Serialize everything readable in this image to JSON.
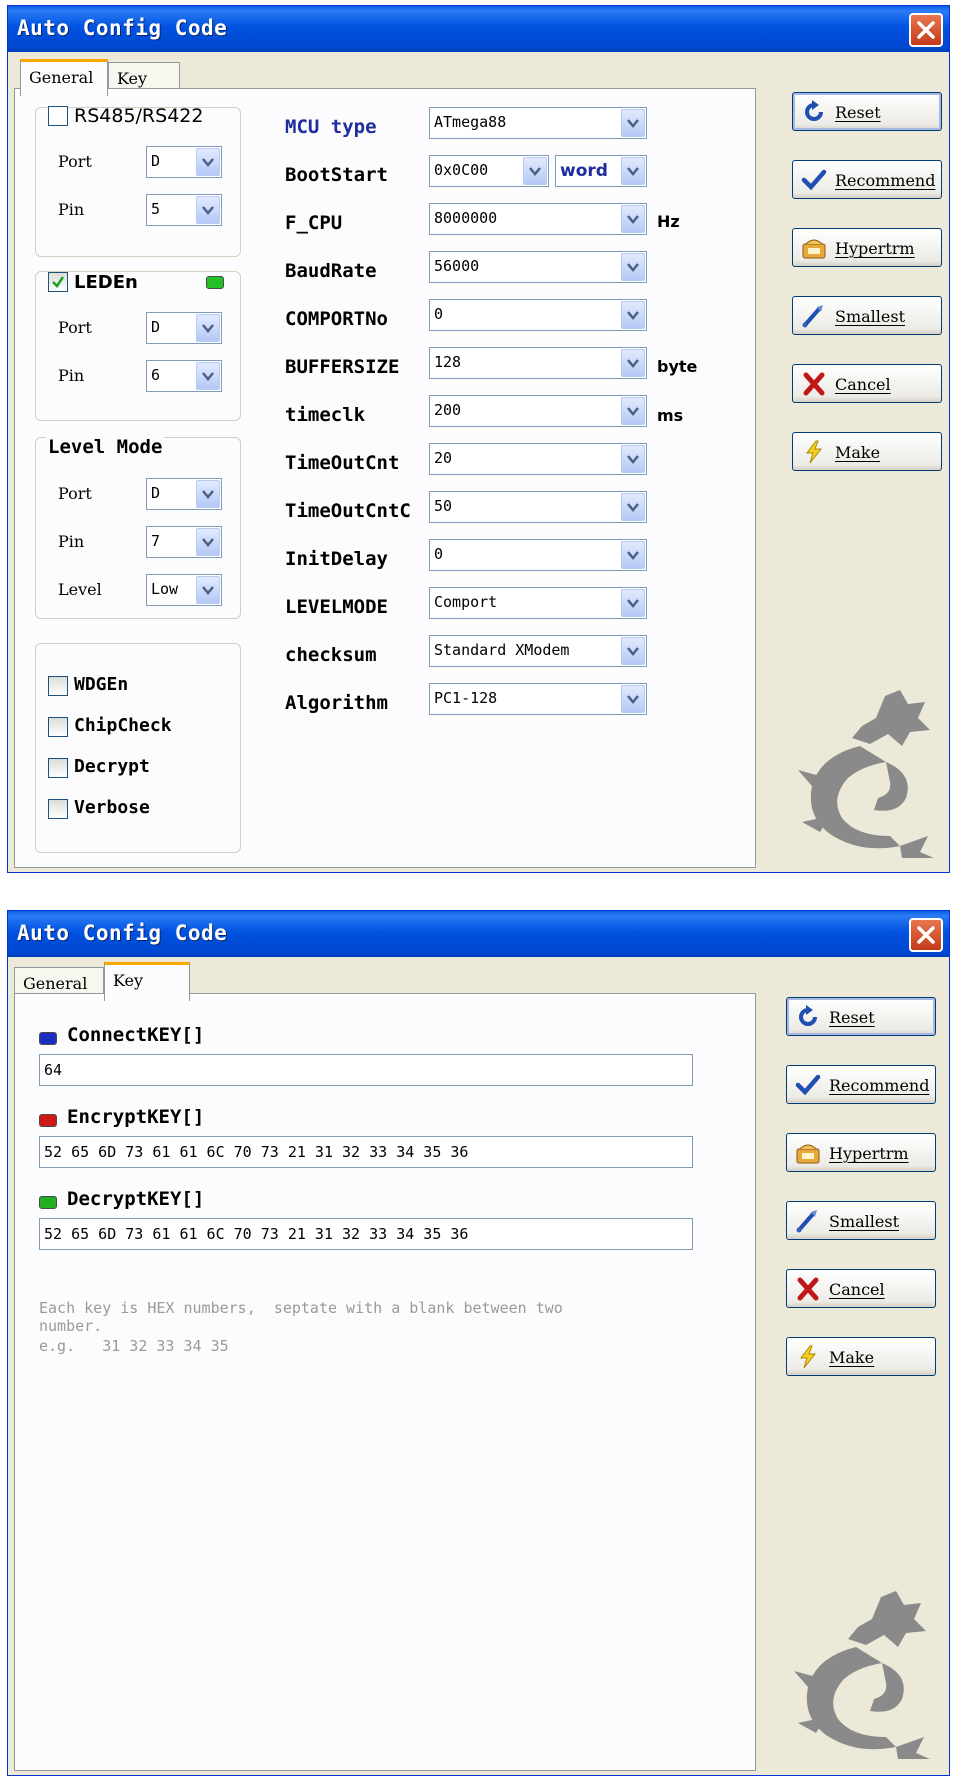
{
  "window": {
    "title": "Auto Config Code"
  },
  "tabs": {
    "general": "General",
    "key": "Key"
  },
  "buttons": {
    "reset": "Reset",
    "recommend": "Recommend",
    "hypertrm": "Hypertrm",
    "smallest": "Smallest",
    "cancel": "Cancel",
    "make": "Make"
  },
  "general": {
    "rs485": {
      "label": "RS485/RS422",
      "checked": false,
      "port_label": "Port",
      "port": "D",
      "pin_label": "Pin",
      "pin": "5"
    },
    "leden": {
      "label": "LEDEn",
      "checked": true,
      "port_label": "Port",
      "port": "D",
      "pin_label": "Pin",
      "pin": "6",
      "led_color": "#22c022"
    },
    "level_mode": {
      "label": "Level Mode",
      "port_label": "Port",
      "port": "D",
      "pin_label": "Pin",
      "pin": "7",
      "level_label": "Level",
      "level": "Low"
    },
    "options": [
      {
        "label": "WDGEn",
        "checked": false
      },
      {
        "label": "ChipCheck",
        "checked": false
      },
      {
        "label": "Decrypt",
        "checked": false
      },
      {
        "label": "Verbose",
        "checked": false
      }
    ],
    "fields": {
      "mcu_type": {
        "label": "MCU type",
        "value": "ATmega88"
      },
      "bootstart": {
        "label": "BootStart",
        "value": "0x0C00",
        "unit_value": "word"
      },
      "f_cpu": {
        "label": "F_CPU",
        "value": "8000000",
        "unit": "Hz"
      },
      "baudrate": {
        "label": "BaudRate",
        "value": "56000"
      },
      "comportno": {
        "label": "COMPORTNo",
        "value": "0"
      },
      "buffersize": {
        "label": "BUFFERSIZE",
        "value": "128",
        "unit": "byte"
      },
      "timeclk": {
        "label": "timeclk",
        "value": "200",
        "unit": "ms"
      },
      "timeoutcnt": {
        "label": "TimeOutCnt",
        "value": "20"
      },
      "timeoutcntc": {
        "label": "TimeOutCntC",
        "value": "50"
      },
      "initdelay": {
        "label": "InitDelay",
        "value": "0"
      },
      "levelmode": {
        "label": "LEVELMODE",
        "value": "Comport"
      },
      "checksum": {
        "label": "checksum",
        "value": "Standard XModem"
      },
      "algorithm": {
        "label": "Algorithm",
        "value": "PC1-128"
      }
    }
  },
  "key": {
    "connect": {
      "label": "ConnectKEY[]",
      "value": "64",
      "color": "#1a2fc0"
    },
    "encrypt": {
      "label": "EncryptKEY[]",
      "value": "52 65 6D 73 61 61 6C 70 73 21 31 32 33 34 35 36",
      "color": "#d01818"
    },
    "decrypt": {
      "label": "DecryptKEY[]",
      "value": "52 65 6D 73 61 61 6C 70 73 21 31 32 33 34 35 36",
      "color": "#22b022"
    },
    "hint_line1": "Each key is HEX numbers,  septate with a blank between two",
    "hint_line2": "number.",
    "hint_line3": "e.g.   31 32 33 34 35"
  },
  "colors": {
    "titlebar": "#0052e0",
    "mcu_label": "#1f2e9c",
    "dragon": "#8a8a8a"
  }
}
